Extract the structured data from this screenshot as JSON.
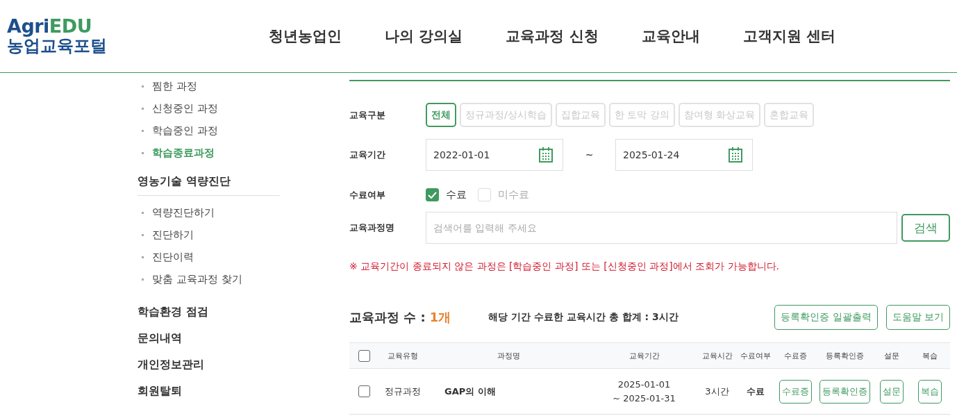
{
  "logo": {
    "brand_part1": "Agri",
    "brand_part2": "EDU",
    "subtitle": "농업교육포털"
  },
  "nav": [
    "청년농업인",
    "나의 강의실",
    "교육과정 신청",
    "교육안내",
    "고객지원 센터"
  ],
  "sidebar": {
    "groups": [
      {
        "items": [
          {
            "label": "찜한 과정",
            "selected": false
          },
          {
            "label": "신청중인 과정",
            "selected": false
          },
          {
            "label": "학습중인 과정",
            "selected": false
          },
          {
            "label": "학습종료과정",
            "selected": true
          }
        ]
      },
      {
        "heading": "영농기술 역량진단",
        "items": [
          {
            "label": "역량진단하기",
            "selected": false
          },
          {
            "label": "진단하기",
            "selected": false
          },
          {
            "label": "진단이력",
            "selected": false
          },
          {
            "label": "맞춤 교육과정 찾기",
            "selected": false
          }
        ]
      }
    ],
    "links": [
      "학습환경 점검",
      "문의내역",
      "개인정보관리",
      "회원탈퇴"
    ]
  },
  "filters": {
    "category": {
      "label": "교육구분",
      "options": [
        {
          "label": "전체",
          "selected": true
        },
        {
          "label": "정규과정/상시학습",
          "selected": false
        },
        {
          "label": "집합교육",
          "selected": false
        },
        {
          "label": "한 토막 강의",
          "selected": false
        },
        {
          "label": "참여형 화상교육",
          "selected": false
        },
        {
          "label": "혼합교육",
          "selected": false
        }
      ]
    },
    "period": {
      "label": "교육기간",
      "start": "2022-01-01",
      "separator": "~",
      "end": "2025-01-24"
    },
    "completion": {
      "label": "수료여부",
      "options": [
        {
          "label": "수료",
          "checked": true
        },
        {
          "label": "미수료",
          "checked": false
        }
      ]
    },
    "course_name": {
      "label": "교육과정명",
      "placeholder": "검색어를 입력해 주세요",
      "search_button": "검색"
    }
  },
  "notice": "※ 교육기간이 종료되지 않은 과정은 [학습중인 과정] 또는 [신청중인 과정]에서 조회가 가능합니다.",
  "summary": {
    "count_label": "교육과정 수 :",
    "count_value": "1개",
    "total_hours": "해당 기간 수료한 교육시간 총 합계 : 3시간",
    "buttons": [
      "등록확인증 일괄출력",
      "도움말 보기"
    ]
  },
  "table": {
    "select_all_checked": false,
    "columns": [
      "교육유형",
      "과정명",
      "교육기간",
      "교육시간",
      "수료여부",
      "수료증",
      "등록확인증",
      "설문",
      "복습"
    ],
    "rows": [
      {
        "checked": false,
        "cells": [
          {
            "kind": "text",
            "text": "정규과정"
          },
          {
            "kind": "title",
            "text": "GAP의 이해"
          },
          {
            "kind": "lines",
            "lines": [
              "2025-01-01",
              "~ 2025-01-31"
            ]
          },
          {
            "kind": "text",
            "text": "3시간"
          },
          {
            "kind": "strong",
            "text": "수료"
          },
          {
            "kind": "button",
            "text": "수료증"
          },
          {
            "kind": "button",
            "text": "등록확인증"
          },
          {
            "kind": "button",
            "text": "설문"
          },
          {
            "kind": "button",
            "text": "복습"
          }
        ]
      }
    ]
  }
}
